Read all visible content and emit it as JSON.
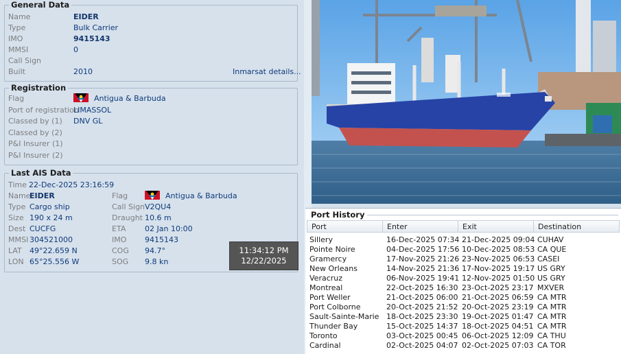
{
  "general": {
    "legend": "General Data",
    "rows": [
      {
        "label": "Name",
        "value": "EIDER",
        "bold": true
      },
      {
        "label": "Type",
        "value": "Bulk Carrier",
        "bold": false
      },
      {
        "label": "IMO",
        "value": "9415143",
        "bold": true
      },
      {
        "label": "MMSI",
        "value": "0",
        "bold": false
      },
      {
        "label": "Call Sign",
        "value": "",
        "bold": false
      },
      {
        "label": "Built",
        "value": "2010",
        "bold": false
      }
    ],
    "inmarsat_link": "Inmarsat details..."
  },
  "registration": {
    "legend": "Registration",
    "rows": [
      {
        "label": "Flag",
        "value": "Antigua & Barbuda",
        "flag": true
      },
      {
        "label": "Port of registration",
        "value": "LIMASSOL"
      },
      {
        "label": "Classed by (1)",
        "value": "DNV GL"
      },
      {
        "label": "Classed by (2)",
        "value": ""
      },
      {
        "label": "P&I Insurer (1)",
        "value": ""
      },
      {
        "label": "P&I Insurer (2)",
        "value": ""
      }
    ]
  },
  "ais": {
    "legend": "Last AIS Data",
    "time_label": "Time",
    "time_value": "22-Dec-2025 23:16:59",
    "left": [
      {
        "label": "Name",
        "value": "EIDER",
        "bold": true
      },
      {
        "label": "Type",
        "value": "Cargo ship"
      },
      {
        "label": "Size",
        "value": "190 x 24 m"
      },
      {
        "label": "Dest",
        "value": "CUCFG"
      },
      {
        "label": "MMSI",
        "value": "304521000"
      },
      {
        "label": "LAT",
        "value": "49°22.659 N"
      },
      {
        "label": "LON",
        "value": "65°25.556 W"
      }
    ],
    "right": [
      {
        "label": "Flag",
        "value": "Antigua & Barbuda",
        "flag": true
      },
      {
        "label": "Call Sign",
        "value": "V2QU4"
      },
      {
        "label": "Draught",
        "value": "10.6 m"
      },
      {
        "label": "ETA",
        "value": "02 Jan 10:00"
      },
      {
        "label": "IMO",
        "value": "9415143"
      },
      {
        "label": "COG",
        "value": "94.7°"
      },
      {
        "label": "SOG",
        "value": "9.8 kn"
      }
    ]
  },
  "clock": {
    "time": "11:34:12 PM",
    "date": "12/22/2025"
  },
  "port_history": {
    "title": "Port History",
    "columns": [
      "Port",
      "Enter",
      "Exit",
      "Destination"
    ],
    "rows": [
      [
        "Sillery",
        "16-Dec-2025 07:34",
        "21-Dec-2025 09:04",
        "CUHAV"
      ],
      [
        "Pointe Noire",
        "04-Dec-2025 17:56",
        "10-Dec-2025 08:53",
        "CA QUE"
      ],
      [
        "Gramercy",
        "17-Nov-2025 21:26",
        "23-Nov-2025 06:53",
        "CASEI"
      ],
      [
        "New Orleans",
        "14-Nov-2025 21:36",
        "17-Nov-2025 19:17",
        "US GRY"
      ],
      [
        "Veracruz",
        "06-Nov-2025 19:41",
        "12-Nov-2025 01:50",
        "US GRY"
      ],
      [
        "Montreal",
        "22-Oct-2025 16:30",
        "23-Oct-2025 23:17",
        "MXVER"
      ],
      [
        "Port Weller",
        "21-Oct-2025 06:00",
        "21-Oct-2025 06:59",
        "CA MTR"
      ],
      [
        "Port Colborne",
        "20-Oct-2025 21:52",
        "20-Oct-2025 23:19",
        "CA MTR"
      ],
      [
        "Sault-Sainte-Marie",
        "18-Oct-2025 23:30",
        "19-Oct-2025 01:47",
        "CA MTR"
      ],
      [
        "Thunder Bay",
        "15-Oct-2025 14:37",
        "18-Oct-2025 04:51",
        "CA MTR"
      ],
      [
        "Toronto",
        "03-Oct-2025 00:45",
        "06-Oct-2025 12:09",
        "CA THU"
      ],
      [
        "Cardinal",
        "02-Oct-2025 04:07",
        "02-Oct-2025 07:03",
        "CA TOR"
      ]
    ]
  },
  "colors": {
    "flag_red": "#ce1126",
    "flag_black": "#000000",
    "flag_blue": "#0072c6",
    "flag_sun": "#fcd116"
  }
}
